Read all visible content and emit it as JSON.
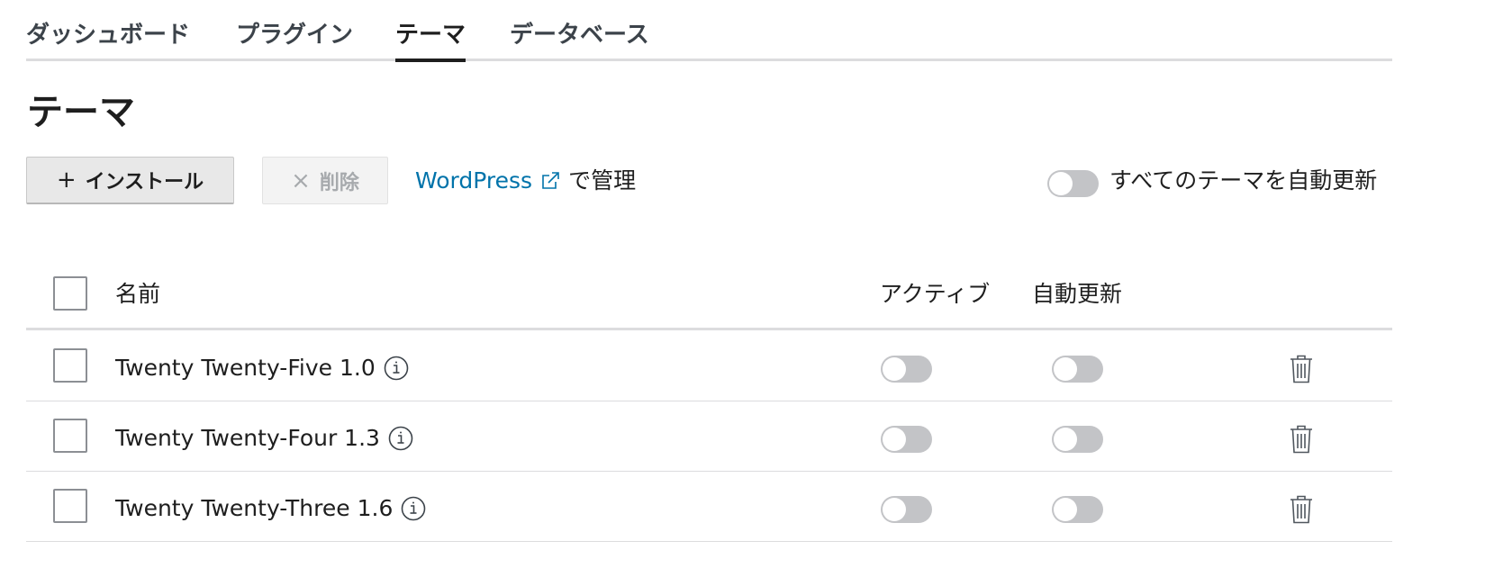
{
  "tabs": [
    {
      "label": "ダッシュボード",
      "active": false
    },
    {
      "label": "プラグイン",
      "active": false
    },
    {
      "label": "テーマ",
      "active": true
    },
    {
      "label": "データベース",
      "active": false
    }
  ],
  "page_title": "テーマ",
  "toolbar": {
    "install_glyph": "+",
    "install_label": "インストール",
    "delete_glyph": "×",
    "delete_label": "削除",
    "manage_link": "WordPress",
    "manage_suffix": "で管理",
    "auto_update_all_label": "すべてのテーマを自動更新"
  },
  "table": {
    "columns": {
      "name": "名前",
      "active": "アクティブ",
      "auto_update": "自動更新"
    },
    "rows": [
      {
        "name": "Twenty Twenty-Five 1.0",
        "active": false,
        "auto_update": false
      },
      {
        "name": "Twenty Twenty-Four 1.3",
        "active": false,
        "auto_update": false
      },
      {
        "name": "Twenty Twenty-Three 1.6",
        "active": false,
        "auto_update": false
      }
    ]
  },
  "icons": [
    "plus-icon",
    "close-icon",
    "external-link-icon",
    "info-icon",
    "trash-icon"
  ],
  "colors": {
    "link": "#0073aa",
    "toggle_off": "#c3c4c7",
    "tab_underline": "#1e1e1e"
  }
}
